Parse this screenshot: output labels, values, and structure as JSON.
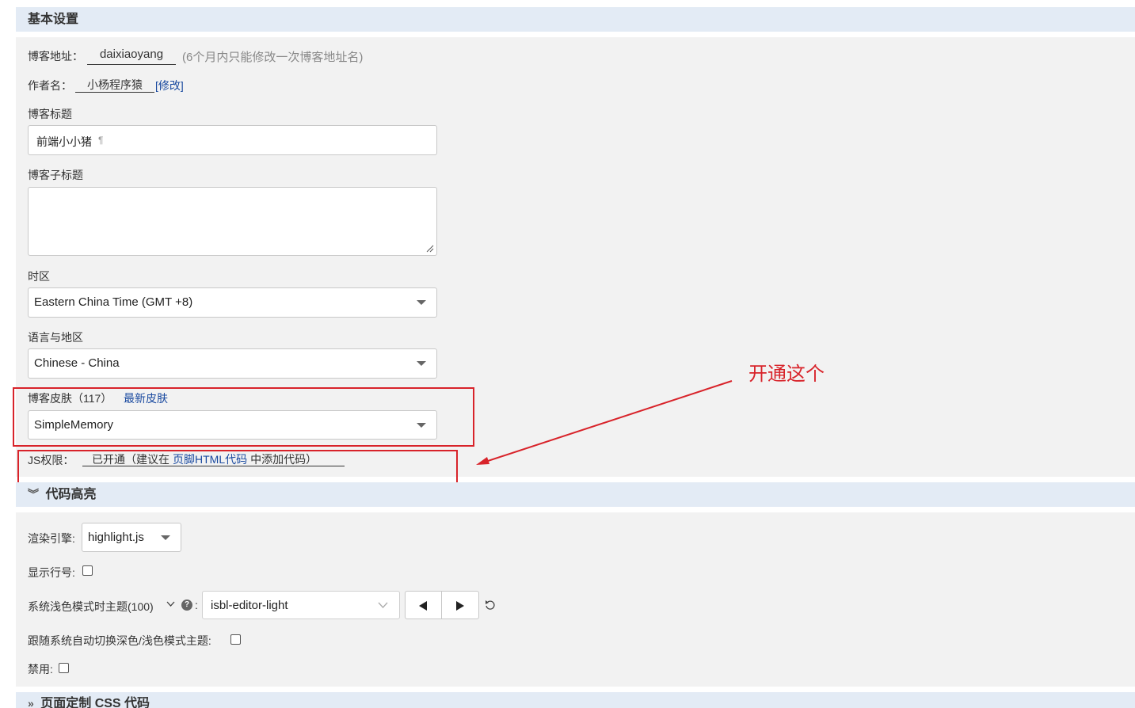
{
  "basic": {
    "section_title": "基本设置",
    "blog_address_label": "博客地址：",
    "blog_address_value": "daixiaoyang",
    "blog_address_note": "(6个月内只能修改一次博客地址名)",
    "author_label": "作者名：",
    "author_value": "小杨程序猿",
    "author_edit": "[修改]",
    "title_label": "博客标题",
    "title_value": "前端小小猪",
    "subtitle_label": "博客子标题",
    "subtitle_value": "",
    "timezone_label": "时区",
    "timezone_value": "Eastern China Time (GMT +8)",
    "locale_label": "语言与地区",
    "locale_value": "Chinese - China",
    "skin_label": "博客皮肤（117）",
    "skin_link": "最新皮肤",
    "skin_value": "SimpleMemory",
    "js_label": "JS权限：",
    "js_status": "已开通（建议在",
    "js_link": "页脚HTML代码",
    "js_suffix": "中添加代码）"
  },
  "annotation": {
    "text": "开通这个",
    "color": "#d8232a"
  },
  "code": {
    "section_title": "代码高亮",
    "engine_label": "渲染引擎:",
    "engine_value": "highlight.js",
    "line_numbers_label": "显示行号:",
    "line_numbers_checked": false,
    "light_theme_label": "系统浅色模式时主题(100)",
    "light_theme_value": "isbl-editor-light",
    "auto_switch_label": "跟随系统自动切换深色/浅色模式主题:",
    "auto_switch_checked": false,
    "disable_label": "禁用:",
    "disable_checked": false
  },
  "css": {
    "section_title": "页面定制 CSS 代码"
  },
  "colors": {
    "section_header_bg": "#e3ebf5",
    "panel_bg": "#f2f2f2",
    "link": "#1a4aa0",
    "highlight_red": "#d8232a"
  }
}
